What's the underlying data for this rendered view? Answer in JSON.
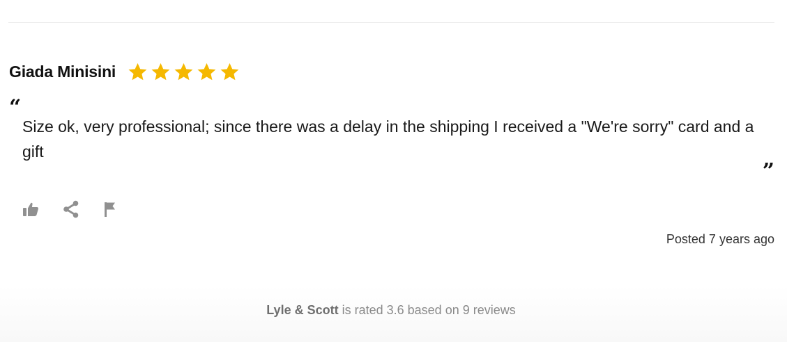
{
  "review": {
    "reviewer_name": "Giada Minisini",
    "rating": 5,
    "rating_max": 5,
    "star_color": "#f5b800",
    "open_quote": "“",
    "text": "Size ok, very professional; since there was a delay in the shipping I received a \"We're sorry\" card and a gift",
    "close_quote": "”",
    "posted": "Posted 7 years ago",
    "actions": [
      {
        "icon": "thumbs-up-icon"
      },
      {
        "icon": "share-icon"
      },
      {
        "icon": "flag-icon"
      }
    ],
    "icon_color": "#909090"
  },
  "summary": {
    "brand": "Lyle & Scott",
    "text": " is rated 3.6 based on 9 reviews"
  }
}
